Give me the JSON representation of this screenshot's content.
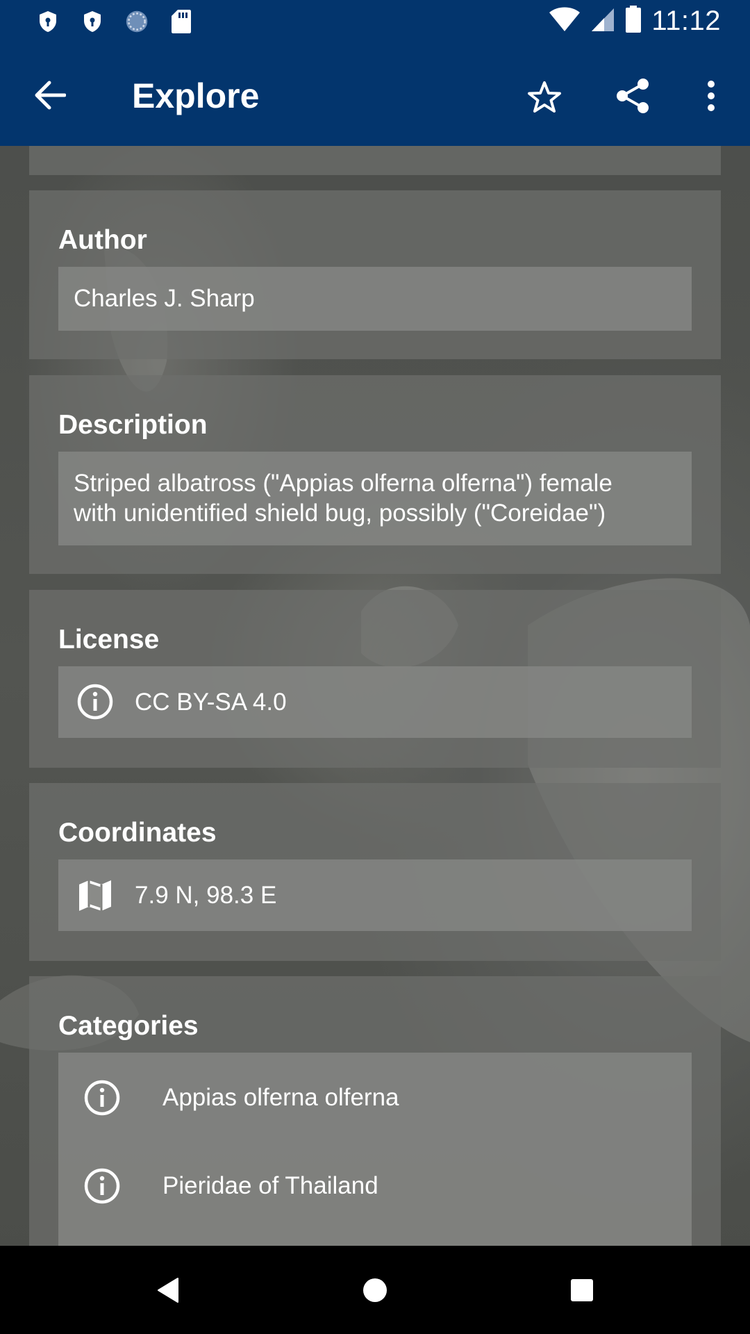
{
  "status_bar": {
    "time": "11:12",
    "icons": [
      "shield-notification-icon",
      "shield-notification-icon",
      "sync-notification-icon",
      "sd-card-icon",
      "wifi-icon",
      "cell-signal-icon",
      "battery-icon"
    ]
  },
  "app_bar": {
    "title": "Explore",
    "icons": [
      "arrow-back-icon",
      "star-outline-icon",
      "share-icon",
      "more-vert-icon"
    ]
  },
  "author": {
    "label": "Author",
    "value": "Charles J. Sharp"
  },
  "description": {
    "label": "Description",
    "line1": "Striped albatross (\"Appias olferna olferna\") female",
    "line2": "with unidentified shield bug, possibly (\"Coreidae\")"
  },
  "license": {
    "label": "License",
    "value": "CC BY-SA 4.0",
    "icon": "info-icon"
  },
  "coordinates": {
    "label": "Coordinates",
    "value": "7.9 N, 98.3 E",
    "icon": "map-icon"
  },
  "categories": {
    "label": "Categories",
    "items": [
      {
        "name": "Appias olferna olferna",
        "icon": "info-icon"
      },
      {
        "name": "Pieridae of Thailand",
        "icon": "info-icon"
      }
    ]
  },
  "nav_bar": {
    "icons": [
      "nav-back-icon",
      "nav-home-icon",
      "nav-recents-icon"
    ]
  }
}
